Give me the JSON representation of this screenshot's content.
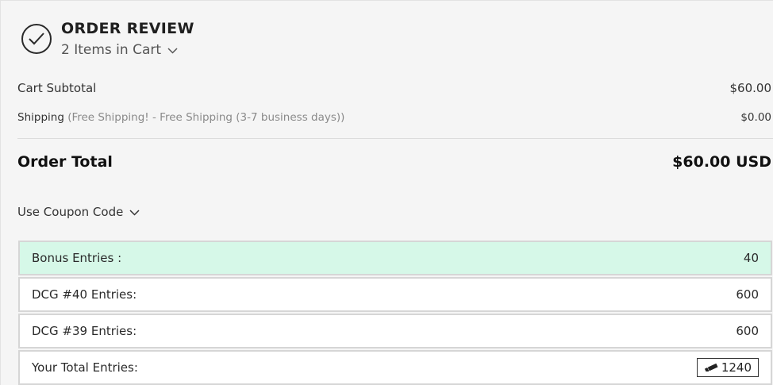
{
  "header": {
    "title": "ORDER REVIEW",
    "items_label": "2 Items in Cart"
  },
  "summary": {
    "subtotal_label": "Cart Subtotal",
    "subtotal_value": "$60.00",
    "shipping_label": "Shipping",
    "shipping_detail": "(Free Shipping! - Free Shipping (3-7 business days))",
    "shipping_value": "$0.00",
    "total_label": "Order Total",
    "total_value": "$60.00 USD"
  },
  "coupon": {
    "label": "Use Coupon Code"
  },
  "entries": [
    {
      "label": "Bonus Entries :",
      "value": "40"
    },
    {
      "label": "DCG #40 Entries:",
      "value": "600"
    },
    {
      "label": "DCG #39 Entries:",
      "value": "600"
    },
    {
      "label": "Your Total Entries:",
      "value": "1240"
    }
  ],
  "icons": {
    "status": "check-circle-icon",
    "toggle": "chevron-down-icon",
    "ticket": "ticket-icon"
  },
  "colors": {
    "bonus_row_bg": "#d6f8e8",
    "page_bg": "#f5f5f5"
  }
}
